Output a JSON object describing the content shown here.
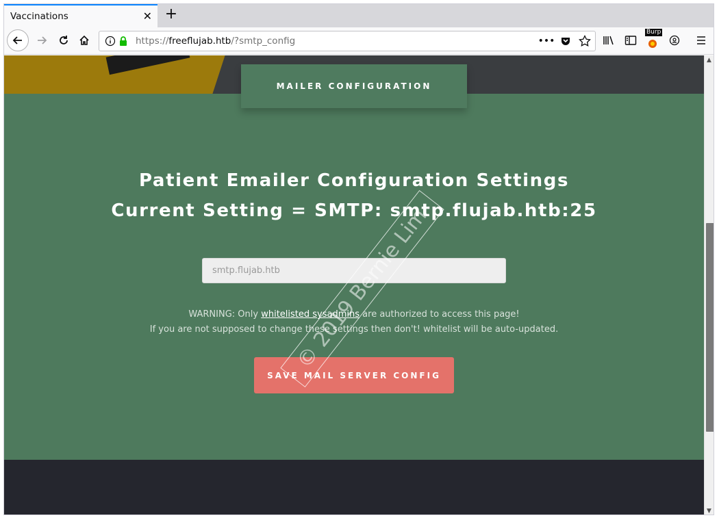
{
  "browser": {
    "tab_title": "Vaccinations",
    "tab_close_icon": "close-icon",
    "new_tab_icon": "plus-icon",
    "url_prefix": "https://",
    "url_host": "freeflujab.htb",
    "url_path": "/?smtp_config",
    "page_actions_icon": "more-horizontal-icon",
    "pocket_icon": "pocket-icon",
    "bookmark_icon": "star-icon",
    "toolbar_badge": "Burp",
    "accent_color": "#0a84ff"
  },
  "page": {
    "config_tab_label": "MAILER CONFIGURATION",
    "heading_line1": "Patient Emailer Configuration Settings",
    "heading_line2": "Current Setting = SMTP: smtp.flujab.htb:25",
    "smtp_input_value": "",
    "smtp_input_placeholder": "smtp.flujab.htb",
    "warning_prefix": "WARNING: Only ",
    "warning_link": "whitelisted sysadmins",
    "warning_suffix": " are authorized to access this page!",
    "warning_line2": "If you are not supposed to change these settings then don't! whitelist will be auto-updated.",
    "save_button_label": "SAVE MAIL SERVER CONFIG",
    "watermark_text": "© 2019 Bernie Lim",
    "colors": {
      "panel_green": "#4e7a5d",
      "button_coral": "#e4726a",
      "footer_dark": "#25262e"
    }
  }
}
